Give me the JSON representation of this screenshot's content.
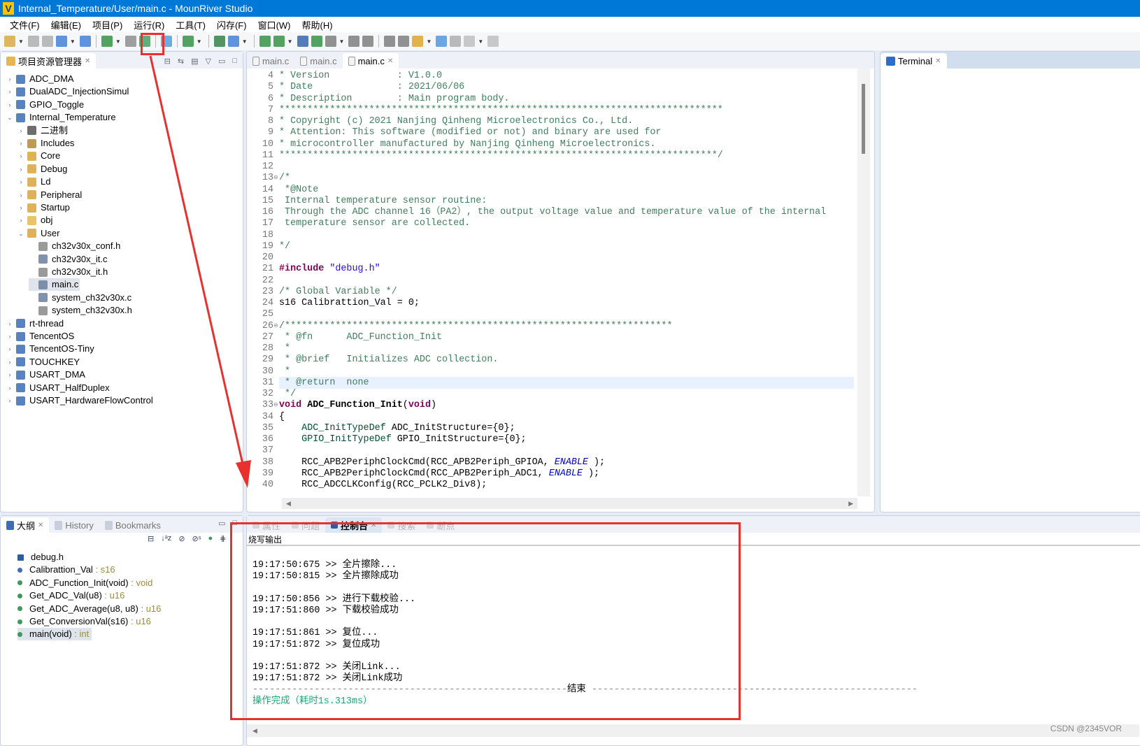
{
  "window": {
    "title": "Internal_Temperature/User/main.c - MounRiver Studio",
    "logo": "V"
  },
  "menu": [
    "文件(F)",
    "编辑(E)",
    "项目(P)",
    "运行(R)",
    "工具(T)",
    "闪存(F)",
    "窗口(W)",
    "帮助(H)"
  ],
  "explorer": {
    "tab": "项目资源管理器",
    "items": [
      {
        "label": "ADC_DMA",
        "level": 0,
        "icon": "project-icon",
        "expanded": false
      },
      {
        "label": "DualADC_InjectionSimul",
        "level": 0,
        "icon": "project-icon",
        "expanded": false
      },
      {
        "label": "GPIO_Toggle",
        "level": 0,
        "icon": "project-icon",
        "expanded": false
      },
      {
        "label": "Internal_Temperature",
        "level": 0,
        "icon": "project-icon",
        "expanded": true
      },
      {
        "label": "二进制",
        "level": 1,
        "icon": "binaries-icon",
        "expanded": false
      },
      {
        "label": "Includes",
        "level": 1,
        "icon": "includes-icon",
        "expanded": false
      },
      {
        "label": "Core",
        "level": 1,
        "icon": "source-folder-icon",
        "expanded": false
      },
      {
        "label": "Debug",
        "level": 1,
        "icon": "source-folder-icon",
        "expanded": false
      },
      {
        "label": "Ld",
        "level": 1,
        "icon": "source-folder-icon",
        "expanded": false
      },
      {
        "label": "Peripheral",
        "level": 1,
        "icon": "source-folder-icon",
        "expanded": false
      },
      {
        "label": "Startup",
        "level": 1,
        "icon": "source-folder-icon",
        "expanded": false
      },
      {
        "label": "obj",
        "level": 1,
        "icon": "folder-icon",
        "expanded": false
      },
      {
        "label": "User",
        "level": 1,
        "icon": "source-folder-icon",
        "expanded": true
      },
      {
        "label": "ch32v30x_conf.h",
        "level": 2,
        "icon": "header-file-icon"
      },
      {
        "label": "ch32v30x_it.c",
        "level": 2,
        "icon": "c-file-icon"
      },
      {
        "label": "ch32v30x_it.h",
        "level": 2,
        "icon": "header-file-icon"
      },
      {
        "label": "main.c",
        "level": 2,
        "icon": "c-file-icon",
        "selected": true
      },
      {
        "label": "system_ch32v30x.c",
        "level": 2,
        "icon": "c-file-icon"
      },
      {
        "label": "system_ch32v30x.h",
        "level": 2,
        "icon": "header-file-icon"
      },
      {
        "label": "rt-thread",
        "level": 0,
        "icon": "project-icon",
        "expanded": false
      },
      {
        "label": "TencentOS",
        "level": 0,
        "icon": "project-icon",
        "expanded": false
      },
      {
        "label": "TencentOS-Tiny",
        "level": 0,
        "icon": "project-icon",
        "expanded": false
      },
      {
        "label": "TOUCHKEY",
        "level": 0,
        "icon": "project-icon",
        "expanded": false
      },
      {
        "label": "USART_DMA",
        "level": 0,
        "icon": "project-icon",
        "expanded": false
      },
      {
        "label": "USART_HalfDuplex",
        "level": 0,
        "icon": "project-icon",
        "expanded": false
      },
      {
        "label": "USART_HardwareFlowControl",
        "level": 0,
        "icon": "project-icon",
        "expanded": false
      }
    ]
  },
  "editor": {
    "tabs": [
      {
        "label": "main.c",
        "active": false
      },
      {
        "label": "main.c",
        "active": false
      },
      {
        "label": "main.c",
        "active": true
      }
    ],
    "highlighted_line": 31,
    "lines": [
      {
        "n": "4",
        "s": [
          [
            "* Version            : V1.0.0",
            "c"
          ]
        ]
      },
      {
        "n": "5",
        "s": [
          [
            "* Date               : 2021/06/06",
            "c"
          ]
        ]
      },
      {
        "n": "6",
        "s": [
          [
            "* Description        : Main program body.",
            "c"
          ]
        ]
      },
      {
        "n": "7",
        "s": [
          [
            "*******************************************************************************",
            "c"
          ]
        ]
      },
      {
        "n": "8",
        "s": [
          [
            "* Copyright (c) 2021 Nanjing Qinheng Microelectronics Co., Ltd.",
            "c"
          ]
        ]
      },
      {
        "n": "9",
        "s": [
          [
            "* Attention: This software (modified or not) and binary are used for",
            "c"
          ]
        ]
      },
      {
        "n": "10",
        "s": [
          [
            "* microcontroller manufactured by Nanjing Qinheng Microelectronics.",
            "c"
          ]
        ]
      },
      {
        "n": "11",
        "s": [
          [
            "******************************************************************************/",
            "c"
          ]
        ]
      },
      {
        "n": "12",
        "s": []
      },
      {
        "n": "13",
        "s": [
          [
            "/*",
            "c"
          ]
        ]
      },
      {
        "n": "14",
        "s": [
          [
            " *@Note",
            "c"
          ]
        ]
      },
      {
        "n": "15",
        "s": [
          [
            " Internal temperature sensor routine:",
            "c"
          ]
        ]
      },
      {
        "n": "16",
        "s": [
          [
            " Through the ADC channel 16（PA2）, the output voltage value and temperature value of the internal",
            "c"
          ]
        ]
      },
      {
        "n": "17",
        "s": [
          [
            " temperature sensor are collected.",
            "c"
          ]
        ]
      },
      {
        "n": "18",
        "s": []
      },
      {
        "n": "19",
        "s": [
          [
            "*/",
            "c"
          ]
        ]
      },
      {
        "n": "20",
        "s": []
      },
      {
        "n": "21",
        "s": [
          [
            "#include ",
            "kw"
          ],
          [
            "\"debug.h\"",
            "str"
          ]
        ]
      },
      {
        "n": "22",
        "s": []
      },
      {
        "n": "23",
        "s": [
          [
            "/* Global Variable */",
            "c"
          ]
        ]
      },
      {
        "n": "24",
        "s": [
          [
            "s16 Calibrattion_Val = 0;",
            ""
          ]
        ]
      },
      {
        "n": "25",
        "s": []
      },
      {
        "n": "26",
        "s": [
          [
            "/*********************************************************************",
            "c"
          ]
        ]
      },
      {
        "n": "27",
        "s": [
          [
            " * @fn      ADC_Function_Init",
            "c"
          ]
        ]
      },
      {
        "n": "28",
        "s": [
          [
            " *",
            "c"
          ]
        ]
      },
      {
        "n": "29",
        "s": [
          [
            " * @brief   Initializes ADC collection.",
            "c"
          ]
        ]
      },
      {
        "n": "30",
        "s": [
          [
            " *",
            "c"
          ]
        ]
      },
      {
        "n": "31",
        "s": [
          [
            " * @return  none",
            "c"
          ]
        ]
      },
      {
        "n": "32",
        "s": [
          [
            " */",
            "c"
          ]
        ]
      },
      {
        "n": "33",
        "s": [
          [
            "void ",
            "kw"
          ],
          [
            "ADC_Function_Init",
            "fn"
          ],
          [
            "(",
            ""
          ],
          [
            "void",
            "kw"
          ],
          [
            ")",
            ""
          ]
        ]
      },
      {
        "n": "34",
        "s": [
          [
            "{",
            ""
          ]
        ]
      },
      {
        "n": "35",
        "s": [
          [
            "    ",
            ""
          ],
          [
            "ADC_InitTypeDef",
            "ty"
          ],
          [
            " ADC_InitStructure={0};",
            ""
          ]
        ]
      },
      {
        "n": "36",
        "s": [
          [
            "    ",
            ""
          ],
          [
            "GPIO_InitTypeDef",
            "ty"
          ],
          [
            " GPIO_InitStructure={0};",
            ""
          ]
        ]
      },
      {
        "n": "37",
        "s": []
      },
      {
        "n": "38",
        "s": [
          [
            "    RCC_APB2PeriphClockCmd(RCC_APB2Periph_GPIOA, ",
            ""
          ],
          [
            "ENABLE",
            "en"
          ],
          [
            " );",
            ""
          ]
        ]
      },
      {
        "n": "39",
        "s": [
          [
            "    RCC_APB2PeriphClockCmd(RCC_APB2Periph_ADC1, ",
            ""
          ],
          [
            "ENABLE",
            "en"
          ],
          [
            " );",
            ""
          ]
        ]
      },
      {
        "n": "40",
        "s": [
          [
            "    RCC_ADCCLKConfig(RCC_PCLK2_Div8);",
            ""
          ]
        ]
      }
    ]
  },
  "terminal": {
    "tab": "Terminal"
  },
  "outline": {
    "tabs": [
      "大纲",
      "History",
      "Bookmarks"
    ],
    "items": [
      {
        "name": "debug.h",
        "type": "",
        "icon": "include-icon"
      },
      {
        "name": "Calibrattion_Val",
        "type": " : s16",
        "icon": "variable-icon"
      },
      {
        "name": "ADC_Function_Init(void)",
        "type": " : void",
        "icon": "function-icon"
      },
      {
        "name": "Get_ADC_Val(u8)",
        "type": " : u16",
        "icon": "function-icon"
      },
      {
        "name": "Get_ADC_Average(u8, u8)",
        "type": " : u16",
        "icon": "function-icon"
      },
      {
        "name": "Get_ConversionVal(s16)",
        "type": " : u16",
        "icon": "function-icon"
      },
      {
        "name": "main(void)",
        "type": " : int",
        "icon": "function-icon",
        "selected": true
      }
    ]
  },
  "console": {
    "tabs": [
      "属性",
      "问题",
      "控制台",
      "搜索",
      "断点"
    ],
    "active_tab": "控制台",
    "title": "烧写输出",
    "lines": [
      "",
      "19:17:50:675 >> 全片擦除...",
      "19:17:50:815 >> 全片擦除成功",
      "",
      "19:17:50:856 >> 进行下载校验...",
      "19:17:51:860 >> 下载校验成功",
      "",
      "19:17:51:861 >> 复位...",
      "19:17:51:872 >> 复位成功",
      "",
      "19:17:51:872 >> 关闭Link...",
      "19:17:51:872 >> 关闭Link成功"
    ],
    "separator": "结束",
    "done": "操作完成（耗时1s.313ms）",
    "done_color": "#19a974"
  },
  "watermark": "CSDN @2345VOR",
  "colors": {
    "titlebar": "#0078d7",
    "annotation": "#e8312f"
  }
}
